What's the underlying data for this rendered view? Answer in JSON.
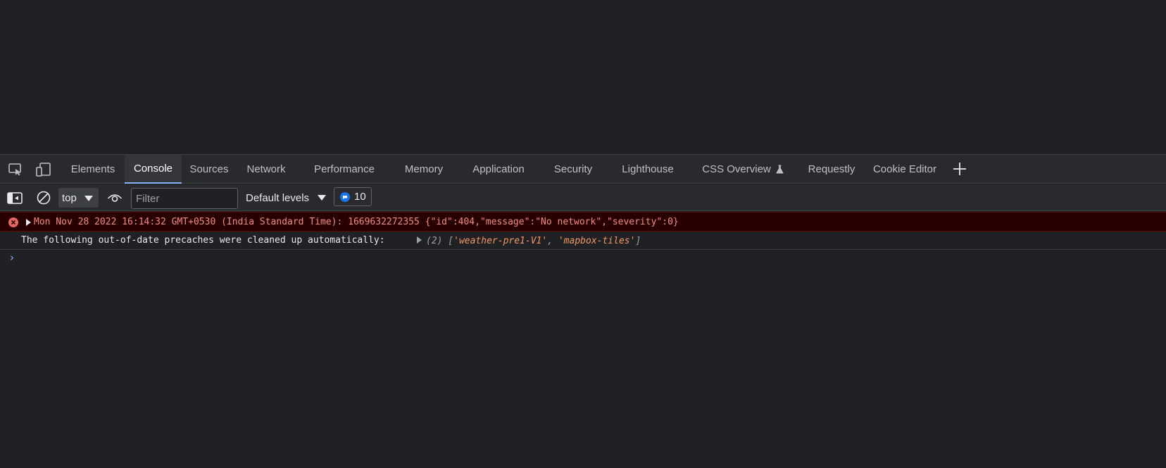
{
  "tabs": [
    {
      "label": "Elements"
    },
    {
      "label": "Console"
    },
    {
      "label": "Sources"
    },
    {
      "label": "Network"
    },
    {
      "label": "Performance"
    },
    {
      "label": "Memory"
    },
    {
      "label": "Application"
    },
    {
      "label": "Security"
    },
    {
      "label": "Lighthouse"
    },
    {
      "label": "CSS Overview"
    },
    {
      "label": "Requestly"
    },
    {
      "label": "Cookie Editor"
    }
  ],
  "active_tab": "Console",
  "toolbar": {
    "context": "top",
    "filter_placeholder": "Filter",
    "levels": "Default levels",
    "issues_count": "10"
  },
  "messages": {
    "error_text": "Mon Nov 28 2022 16:14:32 GMT+0530 (India Standard Time): 1669632272355 {\"id\":404,\"message\":\"No network\",\"severity\":0}",
    "log_text": "The following out-of-date precaches were cleaned up automatically:",
    "log_array_prefix": "(2) [",
    "log_array_item1": "'weather-pre1-V1'",
    "log_array_sep": ", ",
    "log_array_item2": "'mapbox-tiles'",
    "log_array_suffix": "]"
  },
  "prompt_symbol": "›",
  "colors": {
    "accent": "#8ab4f8",
    "error_bg": "#290000",
    "error_text": "#f28b82",
    "string": "#f29766"
  }
}
